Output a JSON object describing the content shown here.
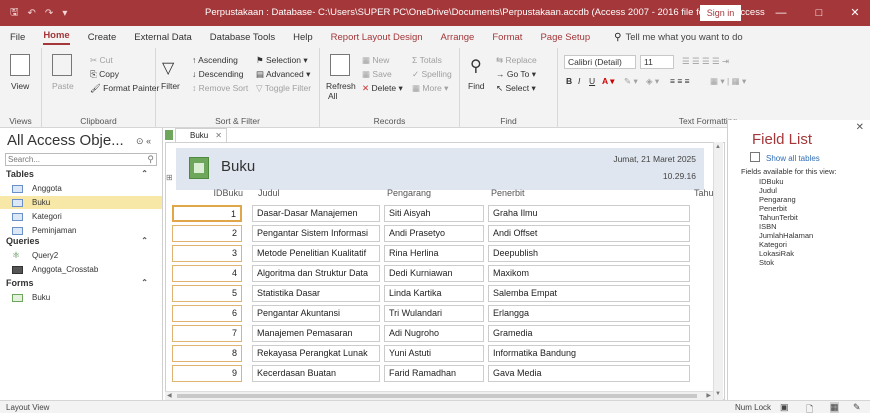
{
  "window": {
    "title": "Perpustakaan : Database- C:\\Users\\SUPER PC\\OneDrive\\Documents\\Perpustakaan.accdb (Access 2007 - 2016 file format) - Access",
    "sign_in": "Sign in",
    "minimize": "—",
    "maximize": "□",
    "close": "✕"
  },
  "tabs": [
    "File",
    "Home",
    "Create",
    "External Data",
    "Database Tools",
    "Help",
    "Report Layout Design",
    "Arrange",
    "Format",
    "Page Setup"
  ],
  "tell_me": "Tell me what you want to do",
  "ribbon": {
    "views": {
      "view": "View",
      "label": "Views"
    },
    "clipboard": {
      "paste": "Paste",
      "cut": "Cut",
      "copy": "Copy",
      "format_painter": "Format Painter",
      "label": "Clipboard"
    },
    "sort": {
      "filter": "Filter",
      "ascending": "Ascending",
      "descending": "Descending",
      "remove_sort": "Remove Sort",
      "selection": "Selection",
      "advanced": "Advanced",
      "toggle_filter": "Toggle Filter",
      "label": "Sort & Filter"
    },
    "records": {
      "refresh": "Refresh",
      "all": "All",
      "new": "New",
      "save": "Save",
      "delete": "Delete",
      "totals": "Totals",
      "spelling": "Spelling",
      "more": "More",
      "label": "Records"
    },
    "find": {
      "find": "Find",
      "replace": "Replace",
      "goto": "Go To",
      "select": "Select",
      "label": "Find"
    },
    "text": {
      "font": "Calibri (Detail)",
      "size": "11",
      "label": "Text Formatting"
    }
  },
  "nav": {
    "title": "All Access Obje...",
    "search": "Search...",
    "sections": [
      {
        "name": "Tables",
        "items": [
          "Anggota",
          "Buku",
          "Kategori",
          "Peminjaman"
        ]
      },
      {
        "name": "Queries",
        "items": [
          "Query2",
          "Anggota_Crosstab"
        ]
      },
      {
        "name": "Forms",
        "items": [
          "Buku"
        ]
      }
    ]
  },
  "doc": {
    "tab": "Buku",
    "title": "Buku",
    "date": "Jumat, 21 Maret 2025",
    "time": "10.29.16",
    "columns": [
      "IDBuku",
      "Judul",
      "Pengarang",
      "Penerbit",
      "Tahu"
    ],
    "rows": [
      [
        "1",
        "Dasar-Dasar Manajemen",
        "Siti Aisyah",
        "Graha Ilmu"
      ],
      [
        "2",
        "Pengantar Sistem Informasi",
        "Andi Prasetyo",
        "Andi Offset"
      ],
      [
        "3",
        "Metode Penelitian Kualitatif",
        "Rina Herlina",
        "Deepublish"
      ],
      [
        "4",
        "Algoritma dan Struktur Data",
        "Dedi Kurniawan",
        "Maxikom"
      ],
      [
        "5",
        "Statistika Dasar",
        "Linda Kartika",
        "Salemba Empat"
      ],
      [
        "6",
        "Pengantar Akuntansi",
        "Tri Wulandari",
        "Erlangga"
      ],
      [
        "7",
        "Manajemen Pemasaran",
        "Adi Nugroho",
        "Gramedia"
      ],
      [
        "8",
        "Rekayasa Perangkat Lunak",
        "Yuni Astuti",
        "Informatika Bandung"
      ],
      [
        "9",
        "Kecerdasan Buatan",
        "Farid Ramadhan",
        "Gava Media"
      ]
    ]
  },
  "field_list": {
    "title": "Field List",
    "show_all": "Show all tables",
    "available": "Fields available for this view:",
    "fields": [
      "IDBuku",
      "Judul",
      "Pengarang",
      "Penerbit",
      "TahunTerbit",
      "ISBN",
      "JumlahHalaman",
      "Kategori",
      "LokasiRak",
      "Stok"
    ]
  },
  "status": {
    "left": "Layout View",
    "num_lock": "Num Lock"
  },
  "colors": {
    "accent": "#a4373a",
    "header_band": "#dfe6ef",
    "selected_nav": "#f7e8a8"
  }
}
